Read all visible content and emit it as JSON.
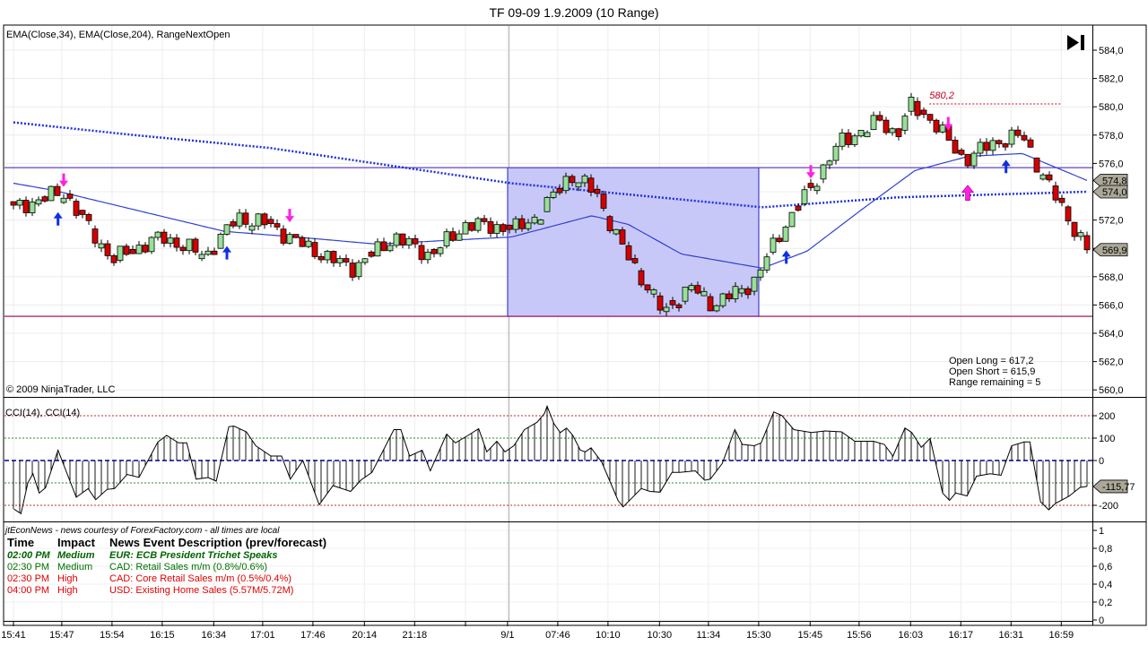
{
  "window_title": "TF 09-09  1.9.2009 (10 Range)",
  "price_panel": {
    "indicators_label": "EMA(Close,34), EMA(Close,204), RangeNextOpen",
    "copyright": "© 2009 NinjaTrader, LLC",
    "info_lines": [
      "Open Long = 617,2",
      "Open Short = 615,9",
      "Range remaining = 5"
    ],
    "high_marker_label": "580,2",
    "price_tags": [
      {
        "label": "574,8",
        "value": 574.8
      },
      {
        "label": "574,0",
        "value": 574.0
      },
      {
        "label": "569,9",
        "value": 569.9
      }
    ],
    "axis_labels": [
      "560,0",
      "562,0",
      "564,0",
      "566,0",
      "568,0",
      "570,0",
      "572,0",
      "574,0",
      "576,0",
      "578,0",
      "580,0",
      "582,0",
      "584,0"
    ]
  },
  "cci_panel": {
    "label": "CCI(14), CCI(14)",
    "axis_labels": [
      "-200",
      "0",
      "100",
      "200"
    ],
    "value_tag": "-115,77"
  },
  "news_panel": {
    "source": "jtEconNews - news courtesy of ForexFactory.com - all times are local",
    "columns": [
      "Time",
      "Impact",
      "News Event Description (prev/forecast)"
    ],
    "rows": [
      {
        "time": "02:00 PM",
        "impact": "Medium",
        "desc": "EUR: ECB President Trichet Speaks",
        "color": "#006400",
        "bold": true
      },
      {
        "time": "02:30 PM",
        "impact": "Medium",
        "desc": "CAD: Retail Sales m/m (0.8%/0.6%)",
        "color": "#007000",
        "bold": false
      },
      {
        "time": "02:30 PM",
        "impact": "High",
        "desc": "CAD: Core Retail Sales m/m (0.5%/0.4%)",
        "color": "#e00000",
        "bold": false
      },
      {
        "time": "04:00 PM",
        "impact": "High",
        "desc": "USD: Existing Home Sales (5.57M/5.72M)",
        "color": "#e00000",
        "bold": false
      }
    ],
    "axis_labels": [
      "0",
      "0,2",
      "0,4",
      "0,6",
      "0,8",
      "1"
    ]
  },
  "time_axis": {
    "labels": [
      "15:41",
      "15:47",
      "15:54",
      "16:15",
      "16:34",
      "17:01",
      "17:46",
      "20:14",
      "21:18",
      "9/1",
      "07:46",
      "10:10",
      "10:30",
      "11:34",
      "15:30",
      "15:45",
      "15:56",
      "16:03",
      "16:17",
      "16:31",
      "16:59"
    ]
  },
  "colors": {
    "up_candle": "#98e098",
    "down_candle": "#d40000",
    "ema34": "#3040d0",
    "ema204": "#2030e0",
    "zone_fill": "#c8c8f8",
    "zone_border": "#2020c0",
    "upper_line": "#6040c8",
    "lower_line": "#900050",
    "signal_long": "#1030e0",
    "signal_short": "#ff20e0",
    "tag_fill": "#aca898"
  },
  "chart_data": {
    "type": "candlestick",
    "title": "TF 09-09  1.9.2009 (10 Range)",
    "bar_count": 172,
    "price_ylim": [
      559.5,
      585
    ],
    "close_path": [
      [
        0,
        572.8
      ],
      [
        7.9,
        574
      ],
      [
        15.7,
        569.2
      ],
      [
        23.6,
        570.8
      ],
      [
        30.7,
        569.5
      ],
      [
        35.7,
        572.2
      ],
      [
        40.7,
        571.7
      ],
      [
        45,
        570.5
      ],
      [
        50.7,
        569.2
      ],
      [
        54.3,
        568.6
      ],
      [
        60.7,
        570.8
      ],
      [
        66.4,
        569.5
      ],
      [
        72.1,
        571.7
      ],
      [
        80,
        571.4
      ],
      [
        83.6,
        572.3
      ],
      [
        88.6,
        575.2
      ],
      [
        92.9,
        573.9
      ],
      [
        96.4,
        570.5
      ],
      [
        103.6,
        565.4
      ],
      [
        107.9,
        567.3
      ],
      [
        111.4,
        566
      ],
      [
        117.9,
        567.6
      ],
      [
        122.1,
        571.1
      ],
      [
        127.1,
        574.3
      ],
      [
        131.4,
        577.4
      ],
      [
        137.9,
        579
      ],
      [
        140.7,
        578
      ],
      [
        142.9,
        580.1
      ],
      [
        146.4,
        579
      ],
      [
        151.4,
        576.2
      ],
      [
        155.7,
        577.4
      ],
      [
        160.7,
        578
      ],
      [
        164.3,
        574.9
      ],
      [
        171,
        569.9
      ]
    ],
    "ema34": [
      [
        0,
        574.6
      ],
      [
        6.4,
        574.1
      ],
      [
        33.6,
        571.2
      ],
      [
        45,
        570.8
      ],
      [
        57.9,
        570.3
      ],
      [
        79.3,
        570.8
      ],
      [
        92.1,
        572.3
      ],
      [
        97.9,
        571.7
      ],
      [
        106.4,
        569.6
      ],
      [
        119.3,
        568.6
      ],
      [
        126.4,
        569.8
      ],
      [
        135,
        572.7
      ],
      [
        143.6,
        575.5
      ],
      [
        152.1,
        576.5
      ],
      [
        160.7,
        576.7
      ],
      [
        171,
        574.8
      ]
    ],
    "ema204": [
      [
        0,
        578.9
      ],
      [
        19.3,
        578.0
      ],
      [
        40.7,
        577.1
      ],
      [
        79.3,
        574.6
      ],
      [
        119.3,
        572.9
      ],
      [
        140.7,
        573.6
      ],
      [
        171,
        574.0
      ]
    ],
    "range_box": {
      "from_bar": 79,
      "to_bar": 119,
      "high": 575.7,
      "low": 565.2
    },
    "horizontal_lines": [
      {
        "price": 575.7,
        "kind": "upper"
      },
      {
        "price": 565.2,
        "kind": "lower"
      }
    ],
    "high_marker": {
      "price": 580.2,
      "from_bar": 145.9,
      "to_bar": 167
    },
    "session_break_bar": 79,
    "signals": [
      {
        "bar": 7.1,
        "price": 572.5,
        "kind": "long"
      },
      {
        "bar": 34,
        "price": 570.1,
        "kind": "long"
      },
      {
        "bar": 123.1,
        "price": 569.8,
        "kind": "long"
      },
      {
        "bar": 158.1,
        "price": 576.2,
        "kind": "long"
      },
      {
        "bar": 8,
        "price": 574.4,
        "kind": "short"
      },
      {
        "bar": 44,
        "price": 571.9,
        "kind": "short"
      },
      {
        "bar": 127,
        "price": 575.0,
        "kind": "short"
      },
      {
        "bar": 148.9,
        "price": 578.4,
        "kind": "short"
      },
      {
        "bar": 152,
        "price": 574.4,
        "kind": "long-big"
      }
    ],
    "time_tick_bars": [
      0,
      7.7,
      15.7,
      23.7,
      31.9,
      39.7,
      47.7,
      55.9,
      63.9,
      78.7,
      86.7,
      94.7,
      102.9,
      110.7,
      118.7,
      126.9,
      134.7,
      142.9,
      150.9,
      158.9,
      166.9
    ],
    "unlabeled_tick_bars": [
      72
    ],
    "cci": {
      "levels": [
        200,
        100,
        0,
        -100,
        -200
      ],
      "ylim": [
        -260,
        260
      ],
      "points": [
        [
          0.1,
          -217
        ],
        [
          1.2,
          -237
        ],
        [
          2.3,
          -99
        ],
        [
          3.1,
          -59
        ],
        [
          4.1,
          -145
        ],
        [
          5.1,
          -122
        ],
        [
          7.1,
          46
        ],
        [
          10,
          -164
        ],
        [
          11.9,
          -125
        ],
        [
          13.1,
          -175
        ],
        [
          14.9,
          -129
        ],
        [
          16.1,
          -125
        ],
        [
          18.1,
          -62
        ],
        [
          20,
          -75
        ],
        [
          23,
          83
        ],
        [
          24.4,
          112
        ],
        [
          26.3,
          79
        ],
        [
          27.6,
          79
        ],
        [
          29.1,
          -83
        ],
        [
          31,
          -76
        ],
        [
          32.3,
          -92
        ],
        [
          34.3,
          151
        ],
        [
          35.1,
          154
        ],
        [
          37.1,
          128
        ],
        [
          38.6,
          66
        ],
        [
          41,
          20
        ],
        [
          42.7,
          20
        ],
        [
          44.1,
          -83
        ],
        [
          46.1,
          0
        ],
        [
          48.7,
          -197
        ],
        [
          50.9,
          -112
        ],
        [
          53.7,
          -138
        ],
        [
          55.4,
          -86
        ],
        [
          57.1,
          -53
        ],
        [
          60.6,
          138
        ],
        [
          61.7,
          138
        ],
        [
          63.1,
          20
        ],
        [
          65.1,
          46
        ],
        [
          66.4,
          -46
        ],
        [
          69,
          118
        ],
        [
          70.4,
          79
        ],
        [
          72.4,
          112
        ],
        [
          74.1,
          142
        ],
        [
          75.4,
          39
        ],
        [
          77,
          86
        ],
        [
          78.3,
          39
        ],
        [
          79.7,
          66
        ],
        [
          81.4,
          138
        ],
        [
          83.4,
          171
        ],
        [
          84.6,
          211
        ],
        [
          85,
          243
        ],
        [
          86.1,
          164
        ],
        [
          87.1,
          125
        ],
        [
          88.1,
          145
        ],
        [
          89.1,
          112
        ],
        [
          90.3,
          46
        ],
        [
          91.1,
          39
        ],
        [
          92,
          57
        ],
        [
          93.7,
          -7
        ],
        [
          96.3,
          -178
        ],
        [
          97.1,
          -207
        ],
        [
          100,
          -125
        ],
        [
          101.4,
          -138
        ],
        [
          103,
          -141
        ],
        [
          104.9,
          -53
        ],
        [
          106.1,
          -53
        ],
        [
          108.6,
          -46
        ],
        [
          110.1,
          -88
        ],
        [
          111,
          -83
        ],
        [
          112.9,
          -13
        ],
        [
          114.9,
          138
        ],
        [
          116.1,
          72
        ],
        [
          118,
          66
        ],
        [
          119.1,
          79
        ],
        [
          121.1,
          217
        ],
        [
          122.4,
          201
        ],
        [
          124.3,
          138
        ],
        [
          127.1,
          125
        ],
        [
          129.3,
          132
        ],
        [
          131.9,
          128
        ],
        [
          134,
          86
        ],
        [
          137,
          86
        ],
        [
          138.7,
          72
        ],
        [
          140.1,
          20
        ],
        [
          142,
          145
        ],
        [
          143.1,
          125
        ],
        [
          144.6,
          59
        ],
        [
          146,
          99
        ],
        [
          148,
          -145
        ],
        [
          149.1,
          -178
        ],
        [
          150.1,
          -145
        ],
        [
          151.9,
          -158
        ],
        [
          153.4,
          -70
        ],
        [
          155.6,
          -59
        ],
        [
          157.3,
          -66
        ],
        [
          159,
          66
        ],
        [
          161,
          83
        ],
        [
          161.9,
          83
        ],
        [
          163.6,
          -184
        ],
        [
          164.9,
          -220
        ],
        [
          166,
          -191
        ],
        [
          168.1,
          -160
        ],
        [
          169.9,
          -120
        ],
        [
          171,
          -115.77
        ]
      ]
    },
    "news_axis_ylim": [
      0,
      1
    ]
  }
}
